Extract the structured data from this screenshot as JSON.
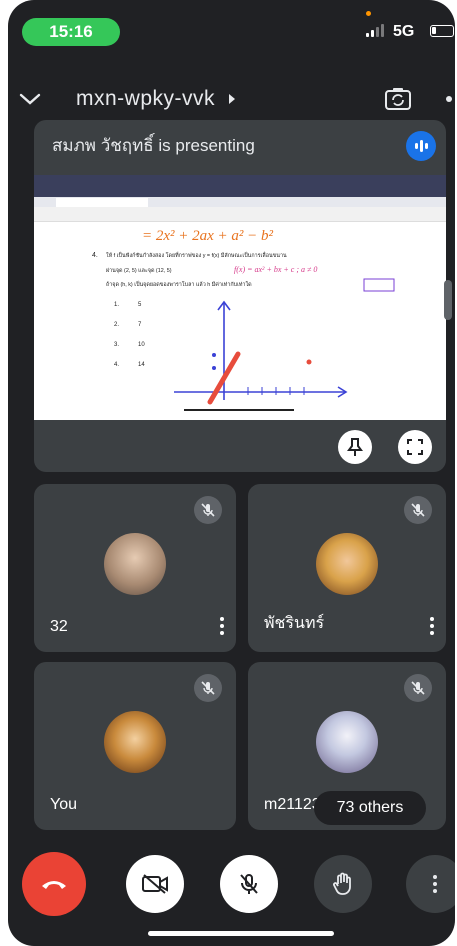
{
  "status_bar": {
    "time": "15:16",
    "network": "5G"
  },
  "header": {
    "meeting_code": "mxn-wpky-vvk",
    "icons": [
      "chevron-down-icon",
      "caret-right-icon",
      "switch-camera-icon"
    ]
  },
  "presentation": {
    "presenter_text": "สมภพ วัชฤทธิ์ is presenting",
    "shared_content": {
      "equation": "= 2x² + 2ax + a² − b²",
      "question_number": "4.",
      "question_line1": "ให้ f เป็นฟังก์ชันกำลังสอง โดยที่กราฟของ y = f(x) มีลักษณะเป็นการเลื่อนขนาน",
      "question_line2": "ผ่านจุด (2, 5) และจุด (12, 5)",
      "handwritten_note": "f(x) = ax² + bx + c ; a ≠ 0",
      "question_line3": "ถ้าจุด (h, k) เป็นจุดยอดของพาราโบลา แล้ว h มีค่าเท่ากับเท่าใด",
      "choices": [
        {
          "num": "1.",
          "val": "5"
        },
        {
          "num": "2.",
          "val": "7"
        },
        {
          "num": "3.",
          "val": "10"
        },
        {
          "num": "4.",
          "val": "14"
        }
      ]
    },
    "controls": [
      "pin-icon",
      "fullscreen-icon"
    ]
  },
  "participants": [
    {
      "name": "32",
      "muted": true,
      "avatar_color": "#c9a88e"
    },
    {
      "name": "พัชรินทร์",
      "muted": true,
      "avatar_color": "#d9a24a"
    },
    {
      "name": "You",
      "muted": true,
      "avatar_color": "#c98a3c"
    },
    {
      "name": "m21123",
      "muted": true,
      "avatar_color": "#9aa4c8"
    }
  ],
  "others": {
    "label": "73 others"
  },
  "call_controls": [
    "end-call-icon",
    "camera-off-icon",
    "mic-off-icon",
    "raise-hand-icon",
    "more-options-icon"
  ],
  "colors": {
    "background": "#202124",
    "tile": "#3c4043",
    "end_call": "#ea4335",
    "status_pill": "#35c759",
    "audio_badge": "#1a73e8"
  }
}
